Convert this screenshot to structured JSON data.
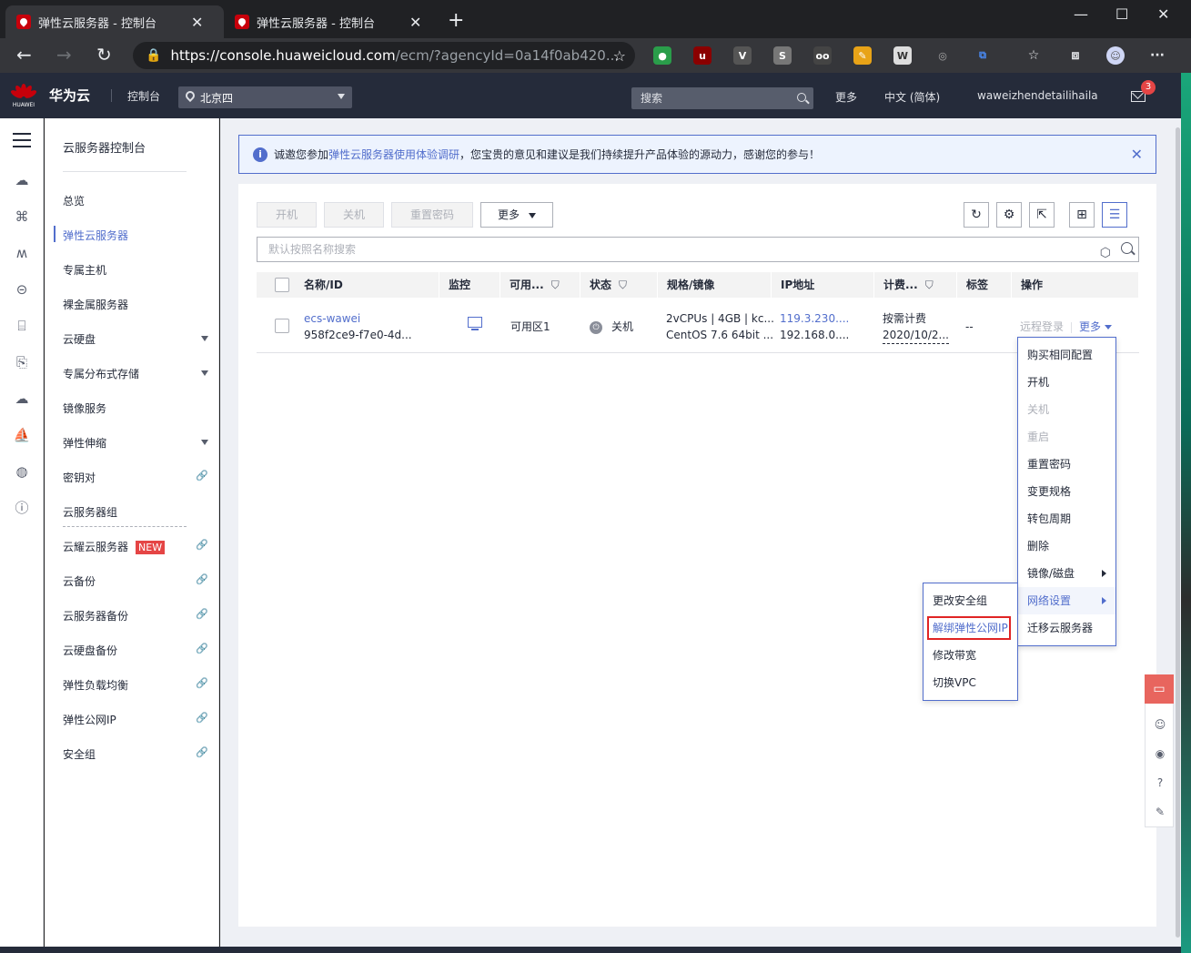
{
  "browser": {
    "tabs": [
      {
        "title": "弹性云服务器 - 控制台"
      },
      {
        "title": "弹性云服务器 - 控制台"
      }
    ],
    "url_host": "https://console.huaweicloud.com",
    "url_path": "/ecm/?agencyId=0a14f0ab420..."
  },
  "header": {
    "logo_text": "HUAWEI",
    "brand": "华为云",
    "console": "控制台",
    "region": "北京四",
    "search_placeholder": "搜索",
    "more": "更多",
    "language": "中文 (简体)",
    "user": "waweizhendetailihaila",
    "mail_count": "3"
  },
  "leftmenu": {
    "title": "云服务器控制台",
    "items": [
      {
        "label": "总览"
      },
      {
        "label": "弹性云服务器"
      },
      {
        "label": "专属主机"
      },
      {
        "label": "裸金属服务器"
      },
      {
        "label": "云硬盘"
      },
      {
        "label": "专属分布式存储"
      },
      {
        "label": "镜像服务"
      },
      {
        "label": "弹性伸缩"
      },
      {
        "label": "密钥对"
      },
      {
        "label": "云服务器组"
      },
      {
        "label": "云耀云服务器",
        "badge": "NEW"
      },
      {
        "label": "云备份"
      },
      {
        "label": "云服务器备份"
      },
      {
        "label": "云硬盘备份"
      },
      {
        "label": "弹性负载均衡"
      },
      {
        "label": "弹性公网IP"
      },
      {
        "label": "安全组"
      }
    ]
  },
  "notice": {
    "prefix": "诚邀您参加",
    "link": "弹性云服务器使用体验调研",
    "suffix": "，您宝贵的意见和建议是我们持续提升产品体验的源动力，感谢您的参与！"
  },
  "toolbar": {
    "start": "开机",
    "stop": "关机",
    "reset_password": "重置密码",
    "more": "更多"
  },
  "search": {
    "placeholder": "默认按照名称搜索"
  },
  "table": {
    "headers": [
      "名称/ID",
      "监控",
      "可用...",
      "状态",
      "规格/镜像",
      "IP地址",
      "计费...",
      "标签",
      "操作"
    ],
    "rows": [
      {
        "name": "ecs-wawei",
        "id": "958f2ce9-f7e0-4d...",
        "zone": "可用区1",
        "status": "关机",
        "spec": "2vCPUs | 4GB | kc...",
        "image": "CentOS 7.6 64bit ...",
        "ip_public": "119.3.230....",
        "ip_private": "192.168.0....",
        "billing": "按需计费",
        "billing_date": "2020/10/2...",
        "tags": "--",
        "op_remote": "远程登录",
        "op_more": "更多"
      }
    ]
  },
  "more_menu": [
    {
      "label": "购买相同配置",
      "disabled": false
    },
    {
      "label": "开机",
      "disabled": false
    },
    {
      "label": "关机",
      "disabled": true
    },
    {
      "label": "重启",
      "disabled": true
    },
    {
      "label": "重置密码",
      "disabled": false
    },
    {
      "label": "变更规格",
      "disabled": false
    },
    {
      "label": "转包周期",
      "disabled": false
    },
    {
      "label": "删除",
      "disabled": false
    },
    {
      "label": "镜像/磁盘",
      "disabled": false
    },
    {
      "label": "网络设置",
      "disabled": false
    },
    {
      "label": "迁移云服务器",
      "disabled": false
    }
  ],
  "network_submenu": [
    {
      "label": "更改安全组"
    },
    {
      "label": "解绑弹性公网IP"
    },
    {
      "label": "修改带宽"
    },
    {
      "label": "切换VPC"
    }
  ],
  "colors": {
    "accent": "#526ecc",
    "header_bg": "#252b3a",
    "brand_red": "#c7000b",
    "highlight_border": "#e02424"
  }
}
